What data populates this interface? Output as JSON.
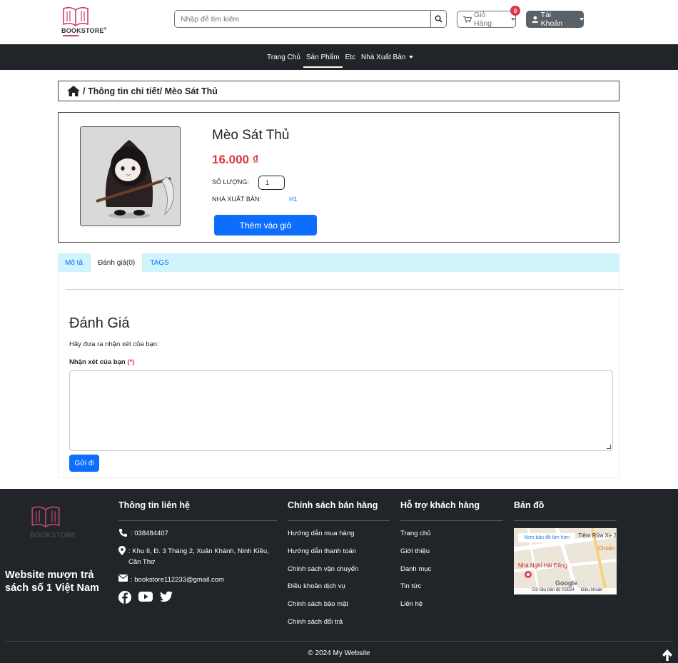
{
  "header": {
    "logo_text": "BOOKSTORE",
    "search_placeholder": "Nhập để tìm kiếm",
    "cart_label": "Giỏ Hàng",
    "cart_count": "0",
    "account_label": "Tài Khoản"
  },
  "nav": {
    "items": [
      "Trang Chủ",
      "Sản Phẩm",
      "Etc",
      "Nhà Xuất Bản"
    ]
  },
  "breadcrumb": {
    "text": "/ Thông tin chi tiết/ Mèo Sát Thủ"
  },
  "product": {
    "title": "Mèo Sát Thủ",
    "price": "16.000 ₫",
    "qty_label": "SỐ LƯỢNG:",
    "qty_value": "1",
    "publisher_label": "NHÀ XUẤT BẢN:",
    "publisher_value": "H1",
    "add_to_cart": "Thêm vào giỏ"
  },
  "tabs": {
    "items": [
      "Mô tả",
      "Đánh giá(0)",
      "TAGS"
    ],
    "active": 1
  },
  "review": {
    "title": "Đánh Giá",
    "prompt": "Hãy đưa ra nhận xét của bạn:",
    "label": "Nhận xét của bạn",
    "required_mark": "(*)",
    "submit": "Gửi đi"
  },
  "footer": {
    "logo_text": "BOOKSTORE",
    "tagline": "Website mượn trả sách số 1 Việt Nam",
    "contact": {
      "title": "Thông tin liên hệ",
      "phone": ": 038484407",
      "address": ": Khu II, Đ. 3 Tháng 2, Xuân Khánh, Ninh Kiều, Cần Thơ",
      "email": ": bookstore112233@gmail.com"
    },
    "policy": {
      "title": "Chính sách bán hàng",
      "items": [
        "Hướng dẫn mua hàng",
        "Hướng dẫn thanh toán",
        "Chính sách vận chuyển",
        "Điều khoản dịch vụ",
        "Chính sách bảo mật",
        "Chính sách đổi trả"
      ]
    },
    "support": {
      "title": "Hỗ trợ khách hàng",
      "items": [
        "Trang chủ",
        "Giới thiệu",
        "Danh mục",
        "Tin tức",
        "Liên hệ"
      ]
    },
    "map": {
      "title": "Bản đồ",
      "view_larger": "Xem bản đồ lớn hơn",
      "place_1": "Tiệm Rửa Xe 2",
      "place_2": "Nhà Nghỉ Hải Đăng",
      "place_3": "Choén",
      "map_data": "Dữ liệu bản đồ ©2024",
      "terms": "Điều khoản",
      "provider": "Google"
    },
    "copyright": "© 2024 My Website"
  },
  "colors": {
    "primary": "#0d6efd",
    "danger": "#dc3545",
    "dark": "#212529",
    "brand": "#d23a6a"
  }
}
